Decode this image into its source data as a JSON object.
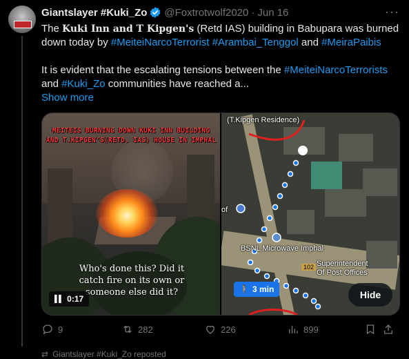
{
  "tweet": {
    "display_name": "Giantslayer #Kuki_Zo",
    "handle": "@Foxtrotwolf2020",
    "separator": "·",
    "date": "Jun 16",
    "more_label": "···",
    "text": {
      "p1_a": "The ",
      "p1_bold": "Kuki Inn and T Kipgen's",
      "p1_b": " (Retd IAS) building in Babupara was burned down today by ",
      "tag1": "#MeiteiNarcoTerrorist",
      "tag2": "#Arambai_Tenggol",
      "p1_and": " and ",
      "tag3": "#MeiraPaibis",
      "p2_a": "It is evident that the escalating tensions between the ",
      "tag4": "#MeiteiNarcoTerrorists",
      "p2_and": " and ",
      "tag5": "#Kuki_Zo",
      "p2_b": " communities have reached a...",
      "show_more": "Show more"
    },
    "media": {
      "video_banner": "MEITEIS BURNING DOWN KUKI INN BUILDING AND T.KIPGEN'S(RETD. IAS) HOUSE IN IMPHAL",
      "video_caption": "Who's done this? Did it catch fire on its own or someone else did it?",
      "video_time": "0:17",
      "map_label_residence": "(T.Kipgen Residence)",
      "map_label_bsnl": "BSNL Microwave Imphal",
      "map_label_road": "102",
      "map_label_super_1": "Superintendent",
      "map_label_super_2": "Of Post Offices",
      "map_label_left": "of",
      "map_walk_time": "3 min",
      "hide_label": "Hide"
    },
    "actions": {
      "replies": "9",
      "reposts": "282",
      "likes": "226",
      "views": "899"
    }
  },
  "next_item": {
    "repost_text": "Giantslayer #Kuki_Zo reposted"
  }
}
